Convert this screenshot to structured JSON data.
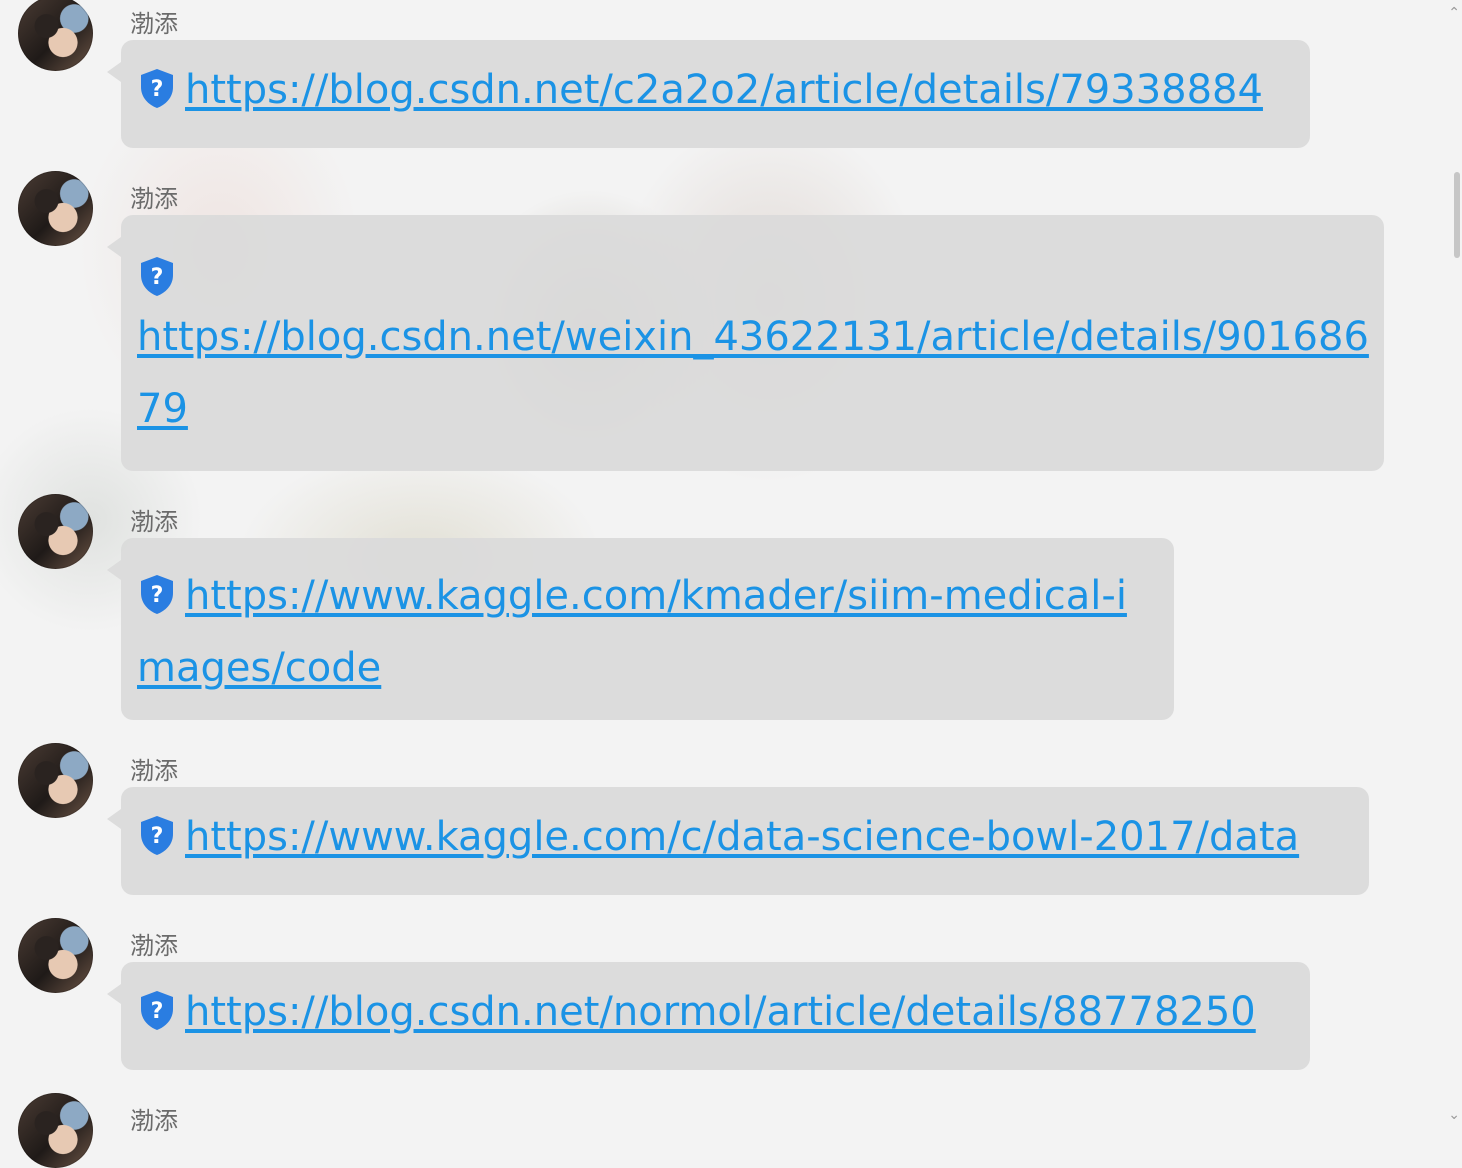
{
  "messages": [
    {
      "sender": "渤添",
      "url": "https://blog.csdn.net/c2a2o2/article/details/79338884"
    },
    {
      "sender": "渤添",
      "url": "https://blog.csdn.net/weixin_43622131/article/details/90168679"
    },
    {
      "sender": "渤添",
      "url": "https://www.kaggle.com/kmader/siim-medical-images/code"
    },
    {
      "sender": "渤添",
      "url": "https://www.kaggle.com/c/data-science-bowl-2017/data"
    },
    {
      "sender": "渤添",
      "url": "https://blog.csdn.net/normol/article/details/88778250"
    },
    {
      "sender": "渤添"
    }
  ],
  "icons": {
    "link_badge": "shield-question-icon",
    "scroll_up": "chevron-up-icon",
    "scroll_down": "chevron-down-icon"
  },
  "colors": {
    "link": "#1b93e5",
    "bubble": "#dadada",
    "sender": "#6b6b6b",
    "shield": "#2a7de1"
  }
}
